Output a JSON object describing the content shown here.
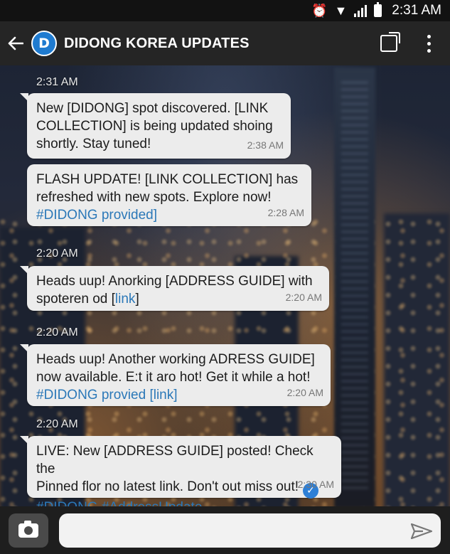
{
  "status_bar": {
    "time": "2:31 AM",
    "icons": [
      "alarm-icon",
      "wifi-icon",
      "signal-icon",
      "battery-icon"
    ]
  },
  "app_bar": {
    "avatar_letter": "D",
    "title": "DIDONG KOREA UPDATES",
    "icons": [
      "back-arrow-icon",
      "square-icon",
      "more-vert-icon"
    ]
  },
  "chat": {
    "timestamps": [
      "2:31 AM",
      "2:20 AM",
      "2:20 AM",
      "2:20 AM"
    ],
    "messages": [
      {
        "lines": [
          "New [DIDONG] spot discovered. [LINK",
          "COLLECTION] is being updated shoing",
          "shortly. Stay tuned!"
        ],
        "time": "2:38 AM"
      },
      {
        "lines": [
          "FLASH UPDATE! [LINK COLLECTION] has",
          "refreshed with new spots. Explore now!"
        ],
        "tag": "#DIDONG  provided]",
        "time": "2:28 AM"
      },
      {
        "line1": "Heads uup! Anorking [ADDRESS GUIDE] with",
        "line2_text": "spoteren od [",
        "line2_link": "link",
        "line2_end": "]",
        "time": "2:20 AM"
      },
      {
        "lines": [
          "Heads uup! Another working ADRESS GUIDE]",
          "now available. E:t it aro hot! Get it while a hot!"
        ],
        "tag": "#DIDONG  provied [link]",
        "time": "2:20 AM"
      },
      {
        "lines": [
          "LIVE: New [ADDRESS GUIDE] posted! Check the",
          "Pinned flor no latest link. Don't out miss out!"
        ],
        "tag": "#DIDONG #AddressUpdate",
        "time": "2:30 AM",
        "verified_icon": "check-circle-icon"
      }
    ]
  },
  "input_bar": {
    "placeholder": "",
    "icons": [
      "camera-icon",
      "send-icon"
    ]
  }
}
